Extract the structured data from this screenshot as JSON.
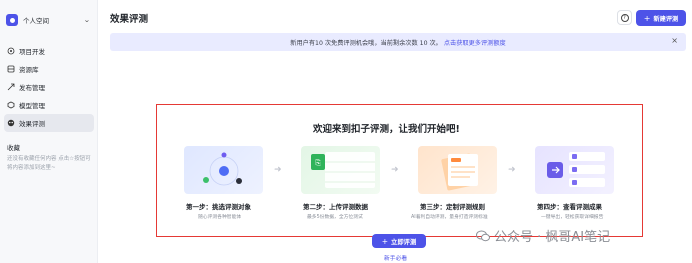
{
  "sidebar": {
    "space_name": "个人空间",
    "items": [
      {
        "label": "项目开发",
        "icon": "project-icon"
      },
      {
        "label": "资源库",
        "icon": "library-icon"
      },
      {
        "label": "发布管理",
        "icon": "publish-icon"
      },
      {
        "label": "模型管理",
        "icon": "model-icon"
      },
      {
        "label": "效果评测",
        "icon": "evaluation-icon",
        "active": true
      }
    ],
    "favorites_title": "收藏",
    "favorites_desc": "还没有收藏任何内容 点击☆按钮可将内容添加到这里~"
  },
  "header": {
    "title": "效果评测",
    "new_button": "新建评测"
  },
  "banner": {
    "text": "新用户有10 次免费评测机会哦，当前剩余次数 10 次。",
    "link": "点击获取更多评测额度"
  },
  "welcome": {
    "title": "欢迎来到扣子评测，让我们开始吧!",
    "steps": [
      {
        "title": "第一步：挑选评测对象",
        "desc": "随心评测各种智能体"
      },
      {
        "title": "第二步：上传评测数据",
        "desc": "最多5份数据，全方位测试"
      },
      {
        "title": "第三步：定制评测规则",
        "desc": "AI着利自动评测，量身打造评测标准"
      },
      {
        "title": "第四步：查看评测成果",
        "desc": "一键导出，轻松获取详细报告"
      }
    ],
    "start_button": "立即评测",
    "guide_link": "新手必看"
  },
  "watermark": {
    "text": "公众号 · 枫哥AI笔记"
  },
  "colors": {
    "accent": "#4d53e8",
    "highlight_border": "#e53935",
    "banner_bg": "#e9ebff"
  }
}
